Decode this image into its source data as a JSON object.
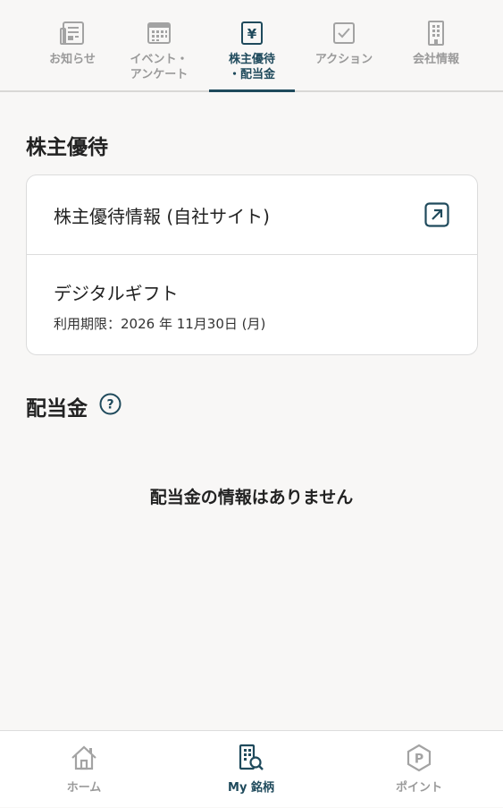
{
  "top_tabs": [
    {
      "label": "お知らせ",
      "icon": "newspaper-icon",
      "active": false
    },
    {
      "label": "イベント・\nアンケート",
      "icon": "calendar-icon",
      "active": false
    },
    {
      "label": "株主優待\n・配当金",
      "icon": "yen-icon",
      "active": true
    },
    {
      "label": "アクション",
      "icon": "checkbox-icon",
      "active": false
    },
    {
      "label": "会社情報",
      "icon": "building-icon",
      "active": false
    }
  ],
  "benefits": {
    "title": "株主優待",
    "info_link_label": "株主優待情報 (自社サイト)",
    "gift_title": "デジタルギフト",
    "gift_expiry": "利用期限：2026 年 11月30日 (月)"
  },
  "dividends": {
    "title": "配当金",
    "empty_message": "配当金の情報はありません"
  },
  "bottom_nav": [
    {
      "label": "ホーム",
      "icon": "home-icon",
      "active": false
    },
    {
      "label": "My 銘柄",
      "icon": "building-search-icon",
      "active": true
    },
    {
      "label": "ポイント",
      "icon": "point-hexagon-icon",
      "active": false
    }
  ],
  "colors": {
    "accent": "#1f4a5c",
    "inactive": "#9a9a9a",
    "background": "#f8f7f6"
  }
}
